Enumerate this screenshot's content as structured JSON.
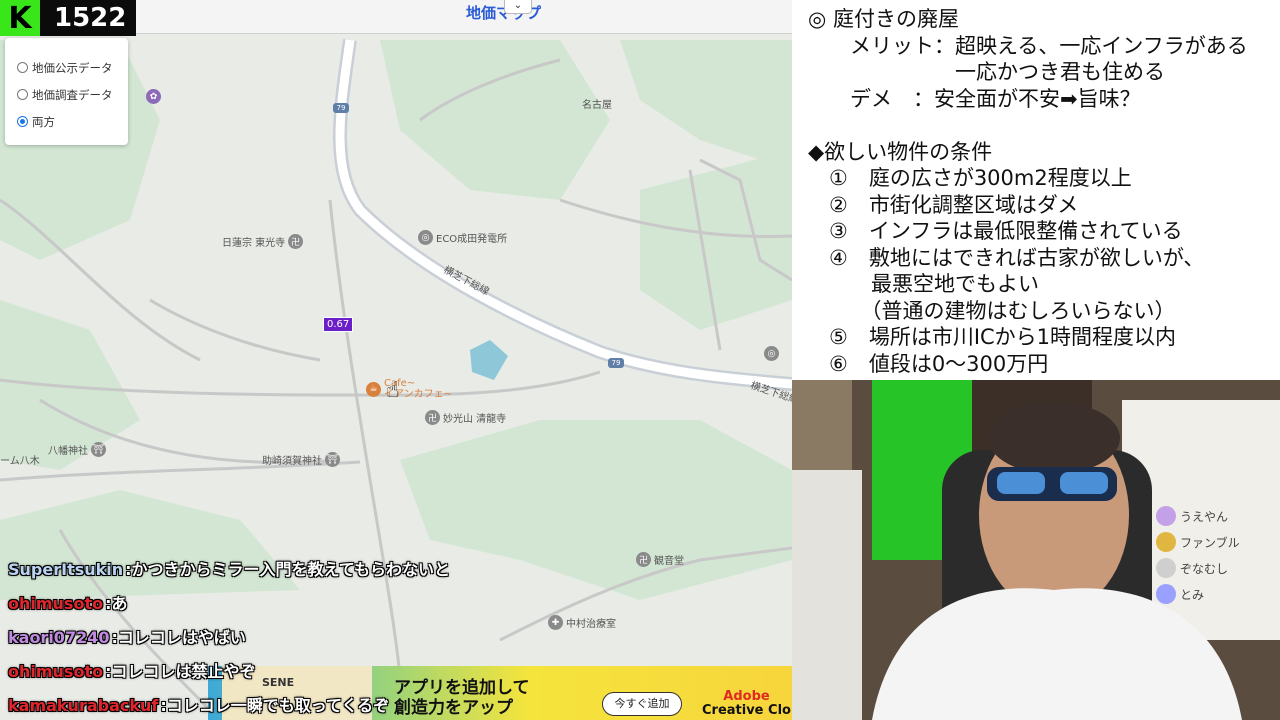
{
  "app": {
    "title": "地価マップ",
    "viewer_count": "1522",
    "logo_letter": "K",
    "accent_green": "#39e61a"
  },
  "radio": {
    "options": [
      {
        "label": "地価公示データ",
        "selected": false
      },
      {
        "label": "地価調査データ",
        "selected": false
      },
      {
        "label": "両方",
        "selected": true
      }
    ]
  },
  "map": {
    "value_marker": "0.67",
    "roads": {
      "route1": "横芝下総線",
      "route2": "横芝下総線",
      "shield1": "79",
      "shield2": "79"
    },
    "labels": {
      "nagoya": "名古屋",
      "toko_temple": "日蓮宗 東光寺",
      "eco": "ECO成田発電所",
      "cafe_top": "Cafe~",
      "cafe": "イアンカフェ~",
      "seiryu": "妙光山 清龍寺",
      "hachiman": "八幡神社",
      "yagi": "ーム八木",
      "susaga": "助崎須賀神社",
      "kannon": "観音堂",
      "nakamura": "中村治療室"
    }
  },
  "chat": [
    {
      "name": "SuperItsukin",
      "color": "#b9d3f0",
      "text": "かつきからミラー入門を教えてもらわないと"
    },
    {
      "name": "ohimusoto",
      "color": "#e0262c",
      "text": "あ"
    },
    {
      "name": "kaori07240",
      "color": "#c08be0",
      "text": "コレコレはやばい"
    },
    {
      "name": "ohimusoto",
      "color": "#e0262c",
      "text": "コレコレは禁止やぞ"
    },
    {
      "name": "kamakurabackuf",
      "color": "#e0262c",
      "text": "コレコレ一瞬でも取ってくるぞ"
    }
  ],
  "ad": {
    "thumb_text": "SENE",
    "headline_1": "アプリを追加して",
    "headline_2": "創造力をアップ",
    "button": "今すぐ追加",
    "brand_1": "Adobe",
    "brand_2": "Creative Clo"
  },
  "notes": {
    "lines": [
      "◎ 庭付きの廃屋",
      "　　メリット：超映える、一応インフラがある",
      "　　　　　　　一応かつき君も住める",
      "　　デメ　：安全面が不安➡旨味？",
      "",
      "◆欲しい物件の条件",
      "　①　庭の広さが300m2程度以上",
      "　②　市街化調整区域はダメ",
      "　③　インフラは最低限整備されている",
      "　④　敷地にはできれば古家が欲しいが、",
      "　　　最悪空地でもよい",
      "　　　（普通の建物はむしろいらない）",
      "　⑤　場所は市川ICから1時間程度以内",
      "　⑥　値段は0～300万円"
    ]
  },
  "cam_overlay": [
    {
      "label": "うえやん",
      "color": "#c4a0e8"
    },
    {
      "label": "ファンブル",
      "color": "#e0b640"
    },
    {
      "label": "ぞなむし",
      "color": "#cfcfcf"
    },
    {
      "label": "とみ",
      "color": "#9aa0ff"
    }
  ]
}
